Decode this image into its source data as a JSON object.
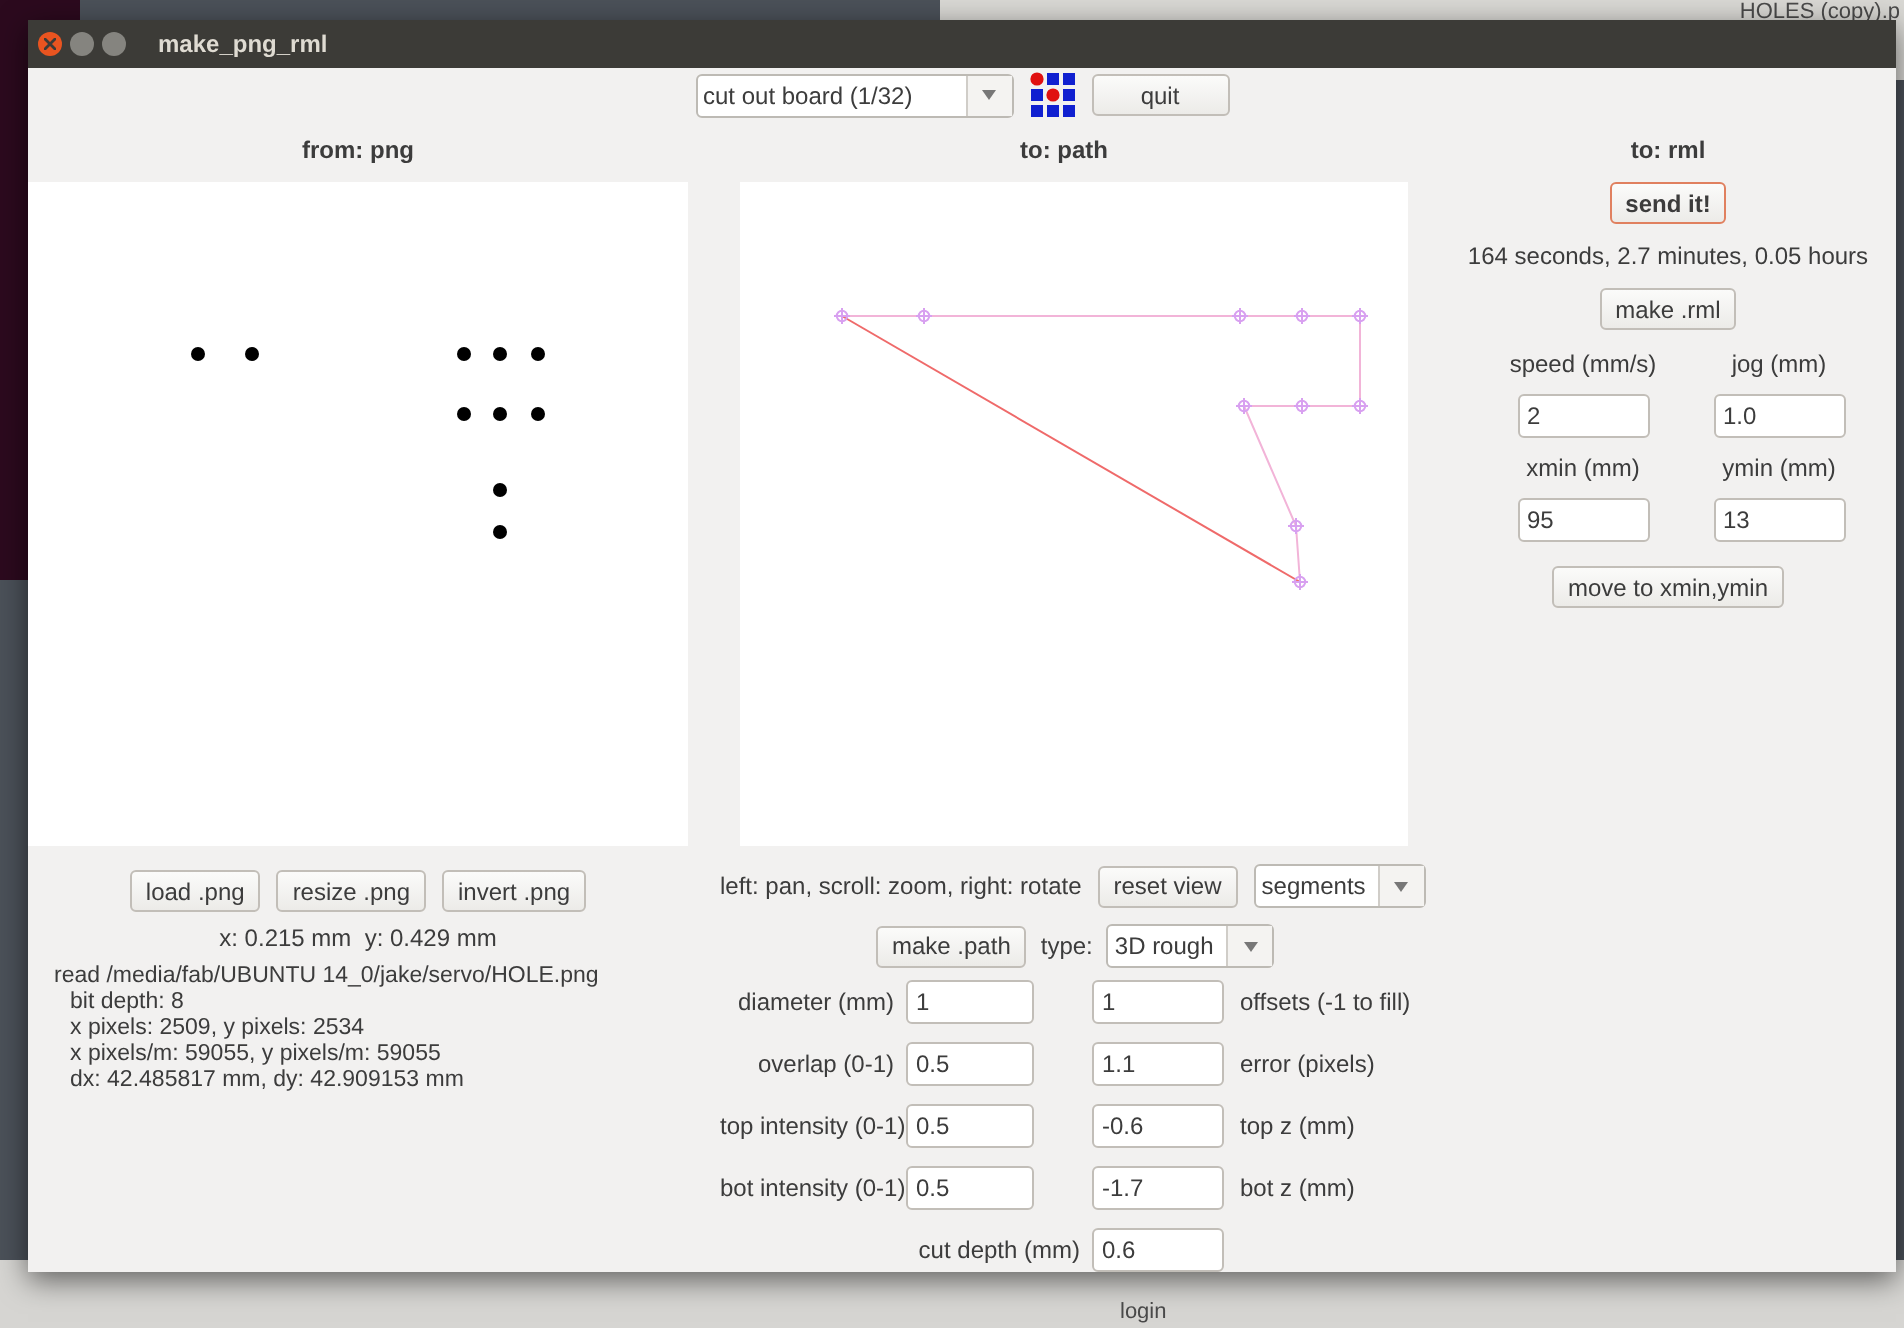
{
  "desktop": {
    "labels": [
      "HOLES (copy).p",
      "login"
    ]
  },
  "window": {
    "title": "make_png_rml"
  },
  "toolbar": {
    "process": "cut out board (1/32)",
    "quit": "quit"
  },
  "from_png": {
    "heading": "from: png",
    "buttons": [
      "load .png",
      "resize .png",
      "invert .png"
    ],
    "coordinates": "x: 0.215 mm  y: 0.429 mm",
    "info": [
      {
        "text": "read /media/fab/UBUNTU 14_0/jake/servo/HOLE.png",
        "indented": false
      },
      {
        "text": "bit depth: 8",
        "indented": true
      },
      {
        "text": "x pixels: 2509, y pixels: 2534",
        "indented": true
      },
      {
        "text": "x pixels/m: 59055, y pixels/m: 59055",
        "indented": true
      },
      {
        "text": "dx: 42.485817 mm, dy: 42.909153 mm",
        "indented": true
      }
    ]
  },
  "to_path": {
    "heading": "to: path",
    "hint": "left: pan, scroll: zoom, right: rotate",
    "reset": "reset view",
    "view_mode": "segments",
    "make": "make .path",
    "type_label": "type:",
    "type_value": "3D rough",
    "rows": [
      {
        "kind": "pair",
        "left_label": "diameter (mm)",
        "left_value": "1",
        "right_value": "1",
        "right_label": "offsets (-1 to fill)"
      },
      {
        "kind": "pair",
        "left_label": "overlap (0-1)",
        "left_value": "0.5",
        "right_value": "1.1",
        "right_label": "error (pixels)"
      },
      {
        "kind": "pair",
        "left_label": "top intensity (0-1)",
        "left_value": "0.5",
        "right_value": "-0.6",
        "right_label": "top z (mm)"
      },
      {
        "kind": "pair",
        "left_label": "bot intensity (0-1)",
        "left_value": "0.5",
        "right_value": "-1.7",
        "right_label": "bot z (mm)"
      },
      {
        "kind": "single",
        "left_label": "cut depth (mm)",
        "right_value": "0.6"
      }
    ]
  },
  "to_rml": {
    "heading": "to: rml",
    "send": "send it!",
    "estimate": "164 seconds, 2.7 minutes, 0.05 hours",
    "make": "make .rml",
    "fields": [
      {
        "label": "speed (mm/s)",
        "value": "2"
      },
      {
        "label": "jog (mm)",
        "value": "1.0"
      },
      {
        "label": "xmin (mm)",
        "value": "95"
      },
      {
        "label": "ymin (mm)",
        "value": "13"
      }
    ],
    "move": "move to xmin,ymin"
  }
}
